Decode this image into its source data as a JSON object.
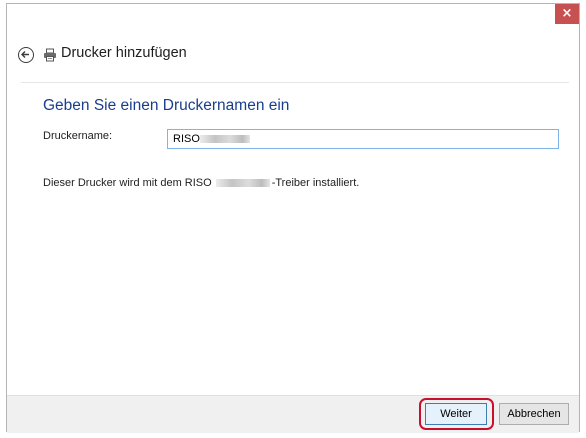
{
  "window": {
    "close_label": "×"
  },
  "header": {
    "title": "Drucker hinzufügen",
    "back_icon": "back-arrow-icon",
    "printer_icon": "printer-icon"
  },
  "content": {
    "heading": "Geben Sie einen Druckernamen ein",
    "field_label": "Druckername:",
    "field_value": "RISO",
    "info_prefix": "Dieser Drucker wird mit dem RISO",
    "info_suffix": "-Treiber installiert."
  },
  "footer": {
    "next_label": "Weiter",
    "cancel_label": "Abbrechen"
  },
  "colors": {
    "heading": "#1a3e8c",
    "close_button": "#c75050",
    "highlight": "#c8102e",
    "input_border": "#7eb4ea"
  }
}
